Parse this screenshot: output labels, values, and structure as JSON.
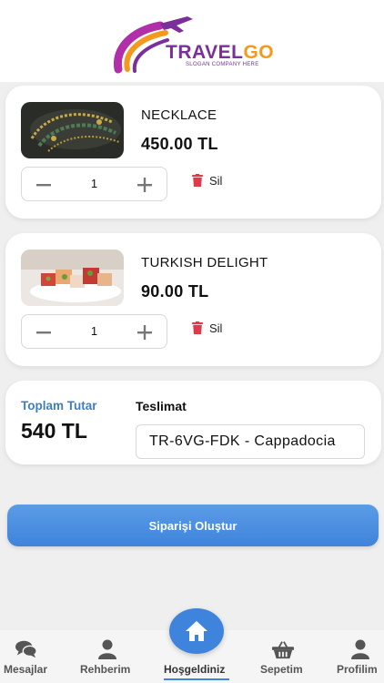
{
  "app": {
    "brand": {
      "name_part1": "TRAVEL",
      "name_part2": "GO",
      "slogan": "SLOGAN COMPANY HERE"
    }
  },
  "cart": {
    "items": [
      {
        "name": "NECKLACE",
        "price": "450.00 TL",
        "quantity": "1",
        "remove_label": "Sil",
        "image_icon": "necklace-photo"
      },
      {
        "name": "TURKISH DELIGHT",
        "price": "90.00 TL",
        "quantity": "1",
        "remove_label": "Sil",
        "image_icon": "turkish-delight-photo"
      }
    ],
    "summary": {
      "total_label": "Toplam Tutar",
      "total_value": "540 TL",
      "delivery_label": "Teslimat",
      "delivery_value": "TR-6VG-FDK - Cappadocia"
    },
    "order_button": "Siparişi Oluştur"
  },
  "nav": {
    "items": [
      {
        "label": "Mesajlar",
        "icon": "chat-icon"
      },
      {
        "label": "Rehberim",
        "icon": "person-icon"
      },
      {
        "label": "Hoşgeldiniz",
        "icon": "home-icon"
      },
      {
        "label": "Sepetim",
        "icon": "basket-icon"
      },
      {
        "label": "Profilim",
        "icon": "user-icon"
      }
    ],
    "active_index": 2
  },
  "colors": {
    "accent": "#3f84dc",
    "total_label": "#3c7fc5",
    "remove_icon": "#e0394a",
    "brand_purple": "#7b2f98",
    "brand_orange": "#f39a1e"
  }
}
